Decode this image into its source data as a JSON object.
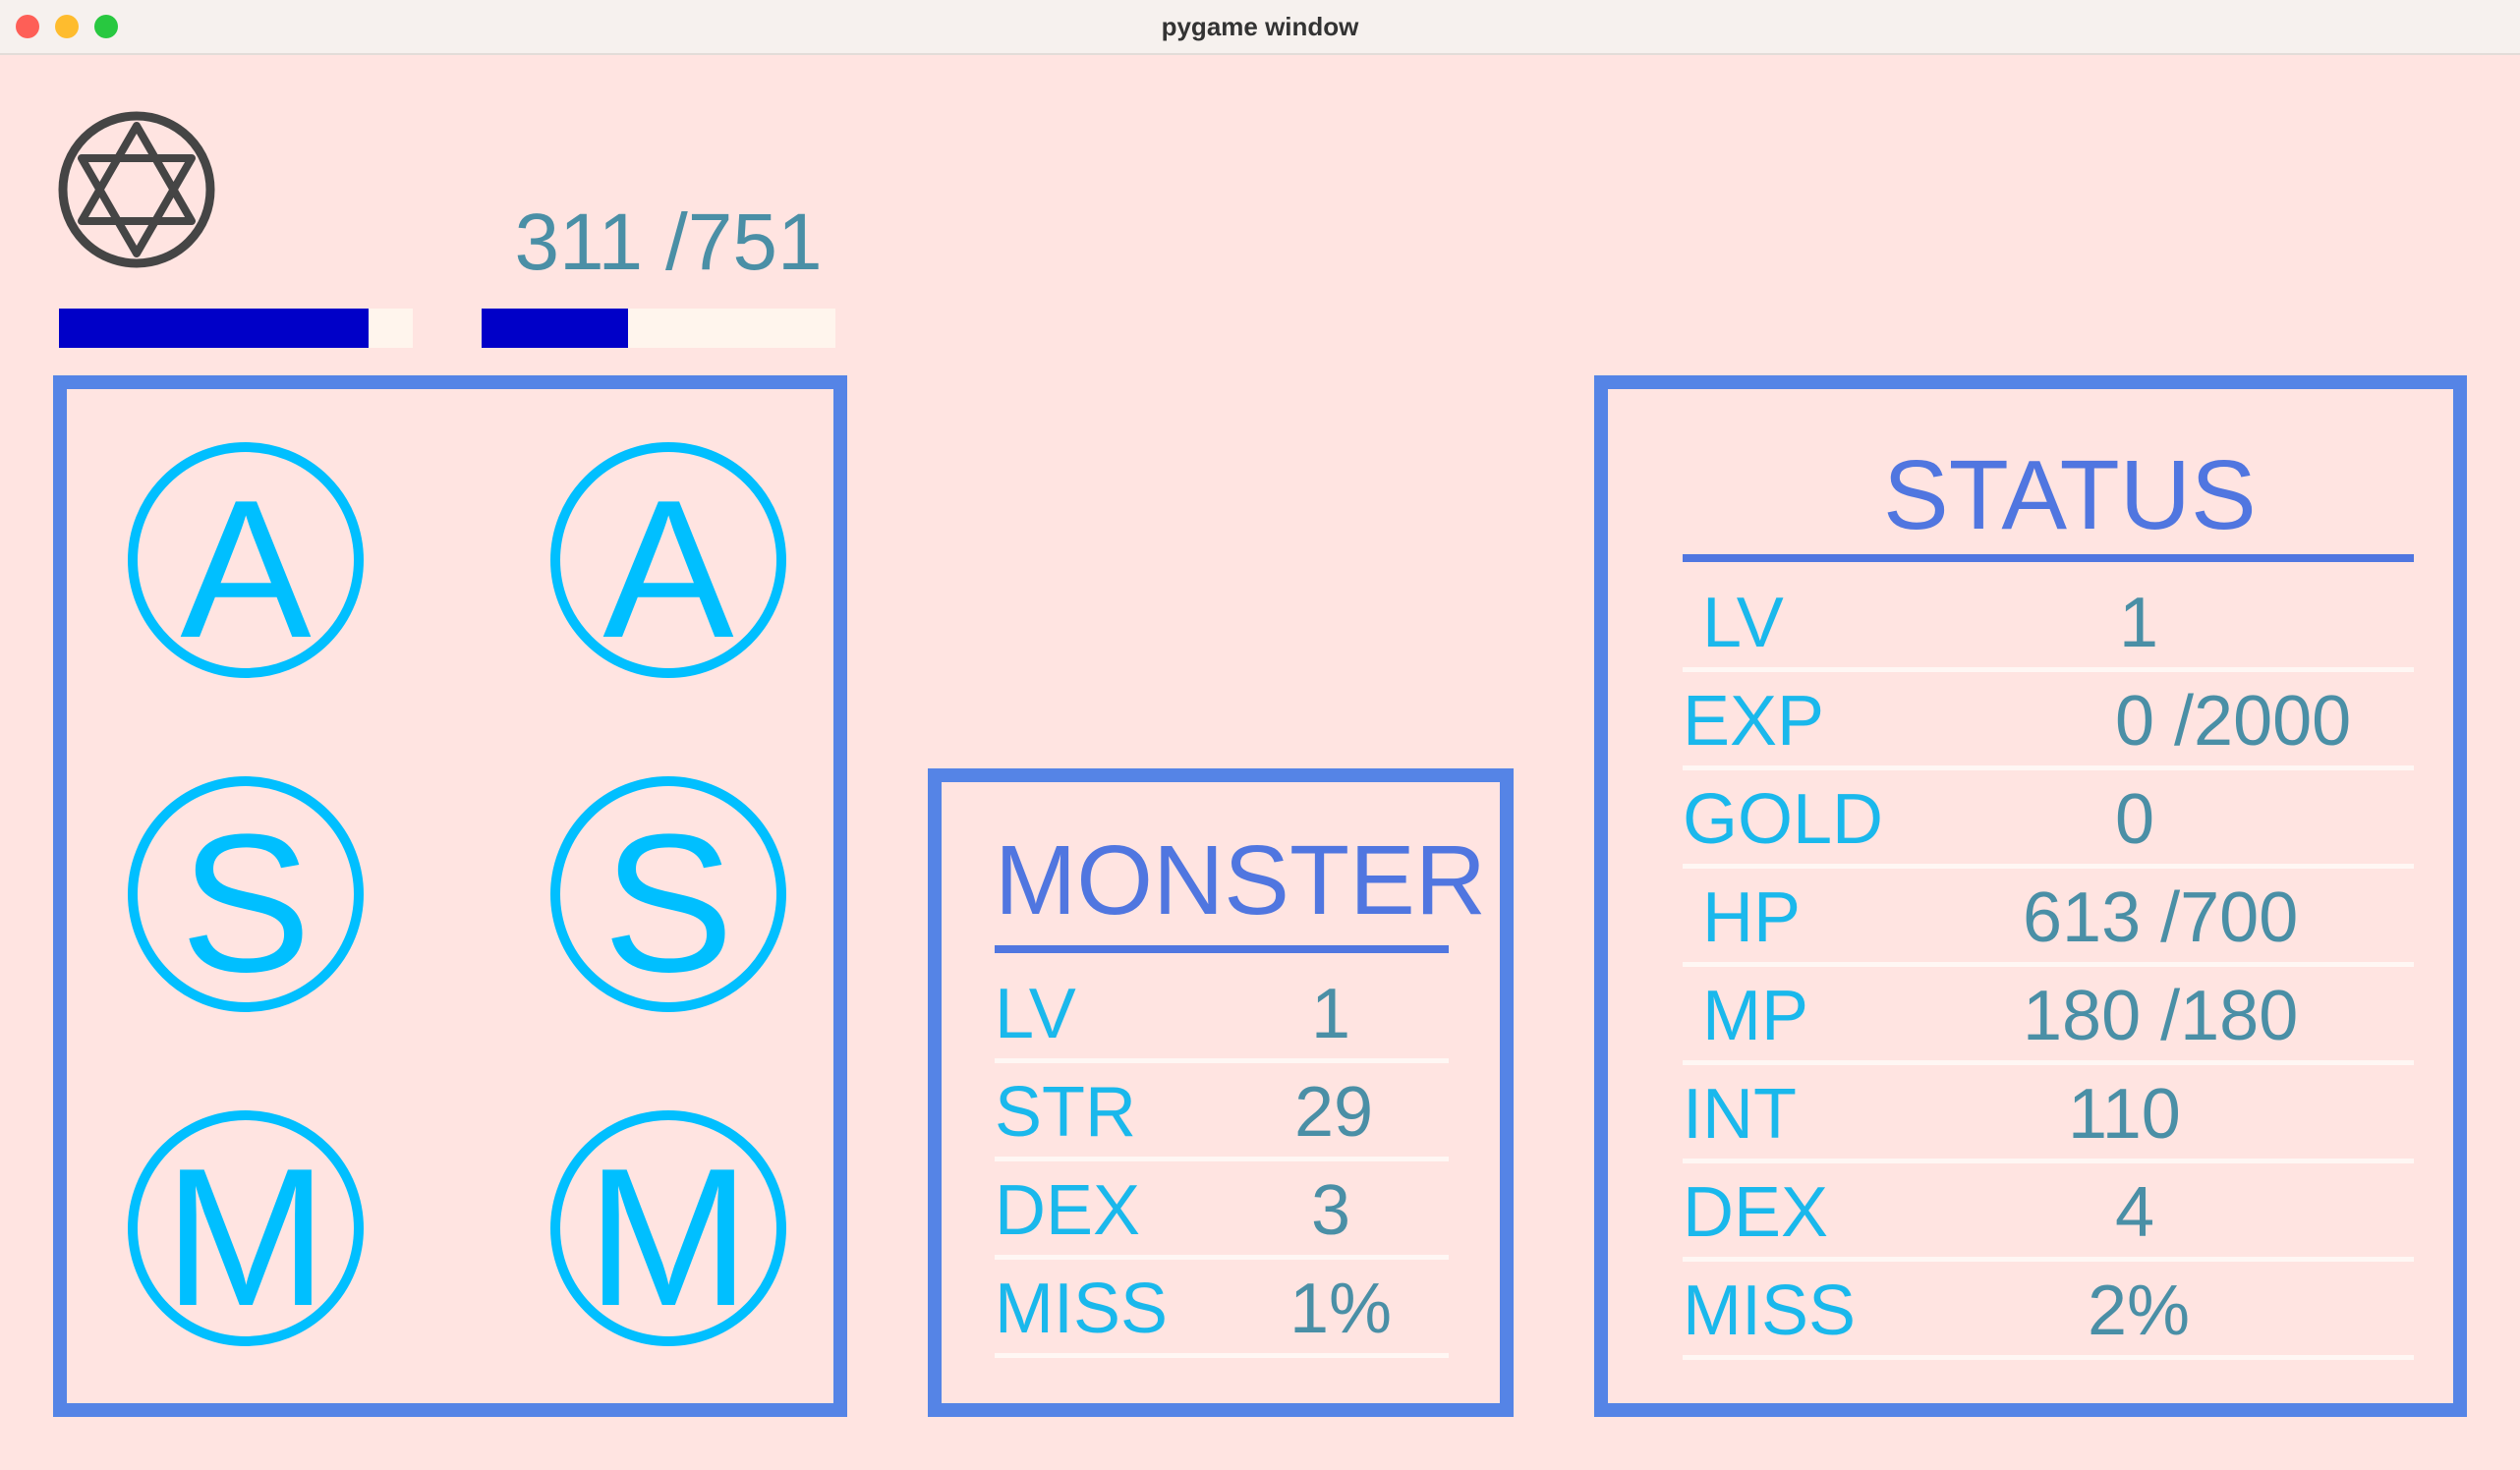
{
  "window": {
    "title": "pygame window"
  },
  "hud": {
    "emblem_icon": "hexagram-emblem-icon",
    "hp_bar_fraction": 0.876,
    "mp_text": "311 /751",
    "mp_bar_fraction": 0.414
  },
  "skills": [
    {
      "label": "A"
    },
    {
      "label": "A"
    },
    {
      "label": "S"
    },
    {
      "label": "S"
    },
    {
      "label": "M"
    },
    {
      "label": "M"
    }
  ],
  "monster": {
    "title": "MONSTER",
    "rows": [
      {
        "label": "LV",
        "value": "1"
      },
      {
        "label": "STR",
        "value": "29"
      },
      {
        "label": "DEX",
        "value": "3"
      },
      {
        "label": "MISS",
        "value": "1%"
      }
    ]
  },
  "status": {
    "title": "STATUS",
    "rows": [
      {
        "label": "LV",
        "value": "1"
      },
      {
        "label": "EXP",
        "value": "0 /2000"
      },
      {
        "label": "GOLD",
        "value": "0"
      },
      {
        "label": "HP",
        "value": "613 /700"
      },
      {
        "label": "MP",
        "value": "180 /180"
      },
      {
        "label": "INT",
        "value": "110"
      },
      {
        "label": "DEX",
        "value": "4"
      },
      {
        "label": "MISS",
        "value": "2%"
      }
    ]
  },
  "colors": {
    "background": "#ffe4e1",
    "panel_border": "#5584e6",
    "skill_accent": "#00bfff",
    "bar_fill": "#0000c8",
    "bar_track": "#fff5ed"
  }
}
